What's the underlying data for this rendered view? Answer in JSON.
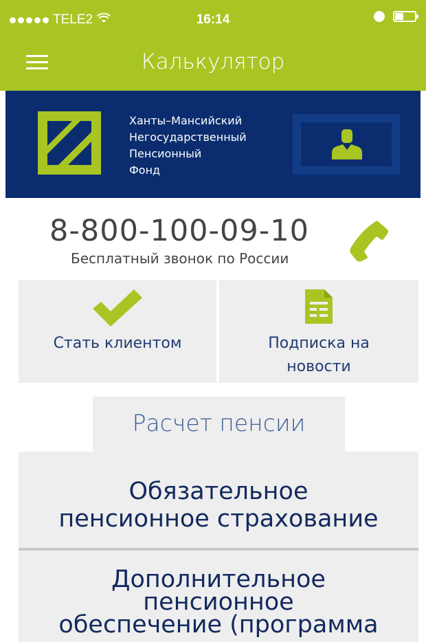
{
  "status_bar": {
    "carrier": "TELE2",
    "time": "16:14",
    "signal_icon": "signal-dots-icon",
    "wifi_icon": "wifi-icon",
    "alarm_icon": "alarm-icon",
    "battery_icon": "battery-icon"
  },
  "nav": {
    "title": "Калькулятор",
    "menu_icon": "hamburger-menu-icon"
  },
  "banner": {
    "org_name_line1": "Ханты–Мансийский",
    "org_name_line2": "Негосударственный",
    "org_name_line3": "Пенсионный",
    "org_name_line4": "Фонд",
    "profile_icon": "user-profile-icon",
    "colors": {
      "bg": "#0b2d6f",
      "accent": "#a8c523"
    }
  },
  "contact": {
    "phone": "8-800-100-09-10",
    "subtitle": "Бесплатный звонок по России",
    "phone_icon": "phone-icon"
  },
  "tiles": {
    "become_client": {
      "label": "Стать клиентом",
      "icon": "checkmark-icon"
    },
    "news": {
      "label_line1": "Подписка на",
      "label_line2": "новости",
      "icon": "document-icon"
    }
  },
  "calculator": {
    "tab_label": "Расчет пенсии",
    "option1_line1": "Обязательное",
    "option1_line2": "пенсионное страхование",
    "option2_line1": "Дополнительное",
    "option2_line2": "пенсионное",
    "option2_line3": "обеспечение (программа"
  }
}
